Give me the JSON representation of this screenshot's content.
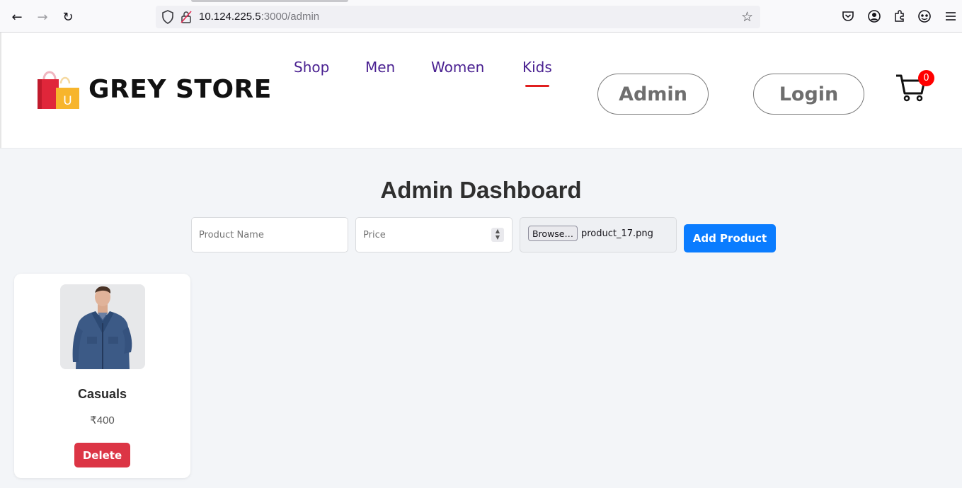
{
  "browser": {
    "url_host": "10.124.225.5",
    "url_path": ":3000/admin"
  },
  "header": {
    "brand": "GREY STORE",
    "nav": [
      {
        "label": "Shop"
      },
      {
        "label": "Men"
      },
      {
        "label": "Women"
      },
      {
        "label": "Kids",
        "active": true
      }
    ],
    "admin_label": "Admin",
    "login_label": "Login",
    "cart_count": "0",
    "logo_letter": "U"
  },
  "dashboard": {
    "title": "Admin Dashboard",
    "product_name_placeholder": "Product Name",
    "price_placeholder": "Price",
    "browse_label": "Browse…",
    "selected_file": "product_17.png",
    "add_label": "Add Product"
  },
  "products": [
    {
      "name": "Casuals",
      "price": "₹400",
      "delete_label": "Delete"
    }
  ],
  "colors": {
    "nav_link": "#4a2191",
    "active_underline": "#e01f1f",
    "add_button": "#0a7cff",
    "delete_button": "#dc3545",
    "cart_badge": "#ff0000"
  }
}
